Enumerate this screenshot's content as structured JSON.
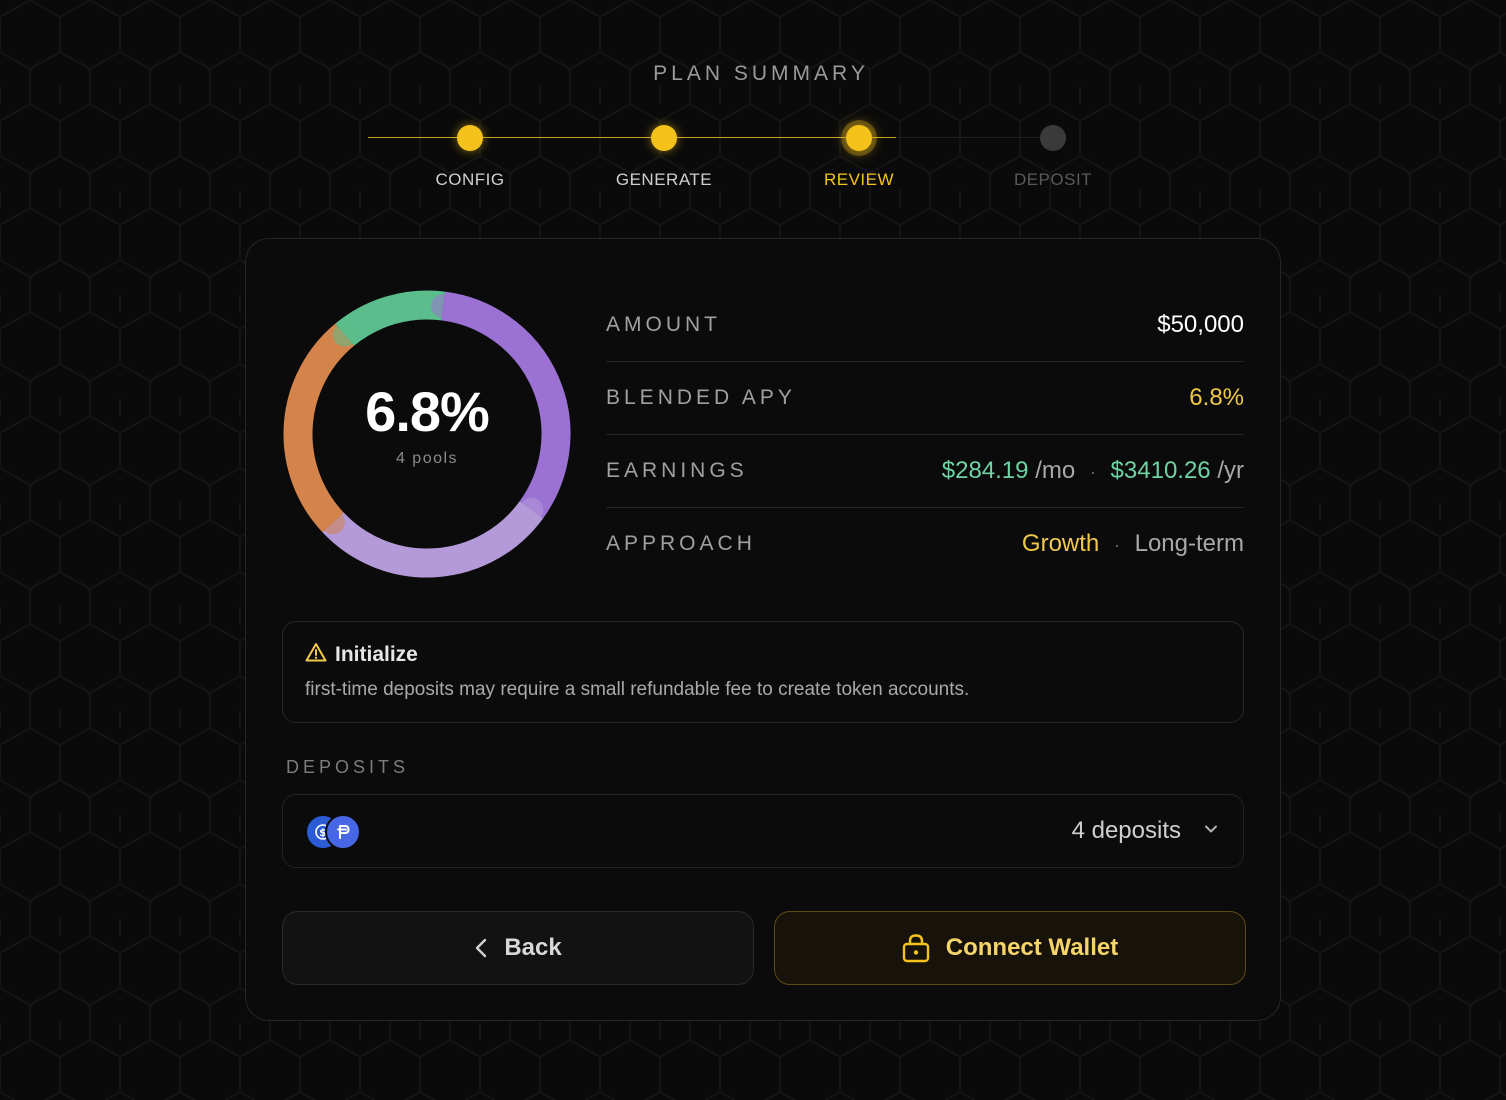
{
  "page": {
    "title": "PLAN SUMMARY"
  },
  "stepper": {
    "steps": [
      {
        "label": "CONFIG",
        "state": "done"
      },
      {
        "label": "GENERATE",
        "state": "done"
      },
      {
        "label": "REVIEW",
        "state": "active"
      },
      {
        "label": "DEPOSIT",
        "state": "todo"
      }
    ]
  },
  "summary": {
    "donut": {
      "value": "6.8%",
      "subtitle": "4 pools",
      "segments": [
        {
          "color": "#9b72d4",
          "fraction": 0.33
        },
        {
          "color": "#b49ad8",
          "fraction": 0.28
        },
        {
          "color": "#d4844a",
          "fraction": 0.26
        },
        {
          "color": "#5bbd8b",
          "fraction": 0.13
        }
      ]
    },
    "amount": {
      "label": "AMOUNT",
      "value": "$50,000"
    },
    "apy": {
      "label": "BLENDED APY",
      "value": "6.8%"
    },
    "earnings": {
      "label": "EARNINGS",
      "monthly": "$284.19",
      "monthly_unit": "/mo",
      "yearly": "$3410.26",
      "yearly_unit": "/yr",
      "separator": "·"
    },
    "approach": {
      "label": "APPROACH",
      "risk": "Growth",
      "horizon": "Long-term",
      "separator": "·"
    }
  },
  "notice": {
    "icon": "warning-icon",
    "title": "Initialize",
    "body": "first-time deposits may require a small refundable fee to create token accounts."
  },
  "deposits": {
    "label": "DEPOSITS",
    "count_text": "4 deposits",
    "tokens": [
      "usdc-token-icon",
      "pyusd-token-icon"
    ]
  },
  "actions": {
    "back_label": "Back",
    "connect_label": "Connect Wallet"
  },
  "colors": {
    "accent": "#f5c21b",
    "green": "#6fd3a3",
    "background": "#0a0a0a"
  }
}
